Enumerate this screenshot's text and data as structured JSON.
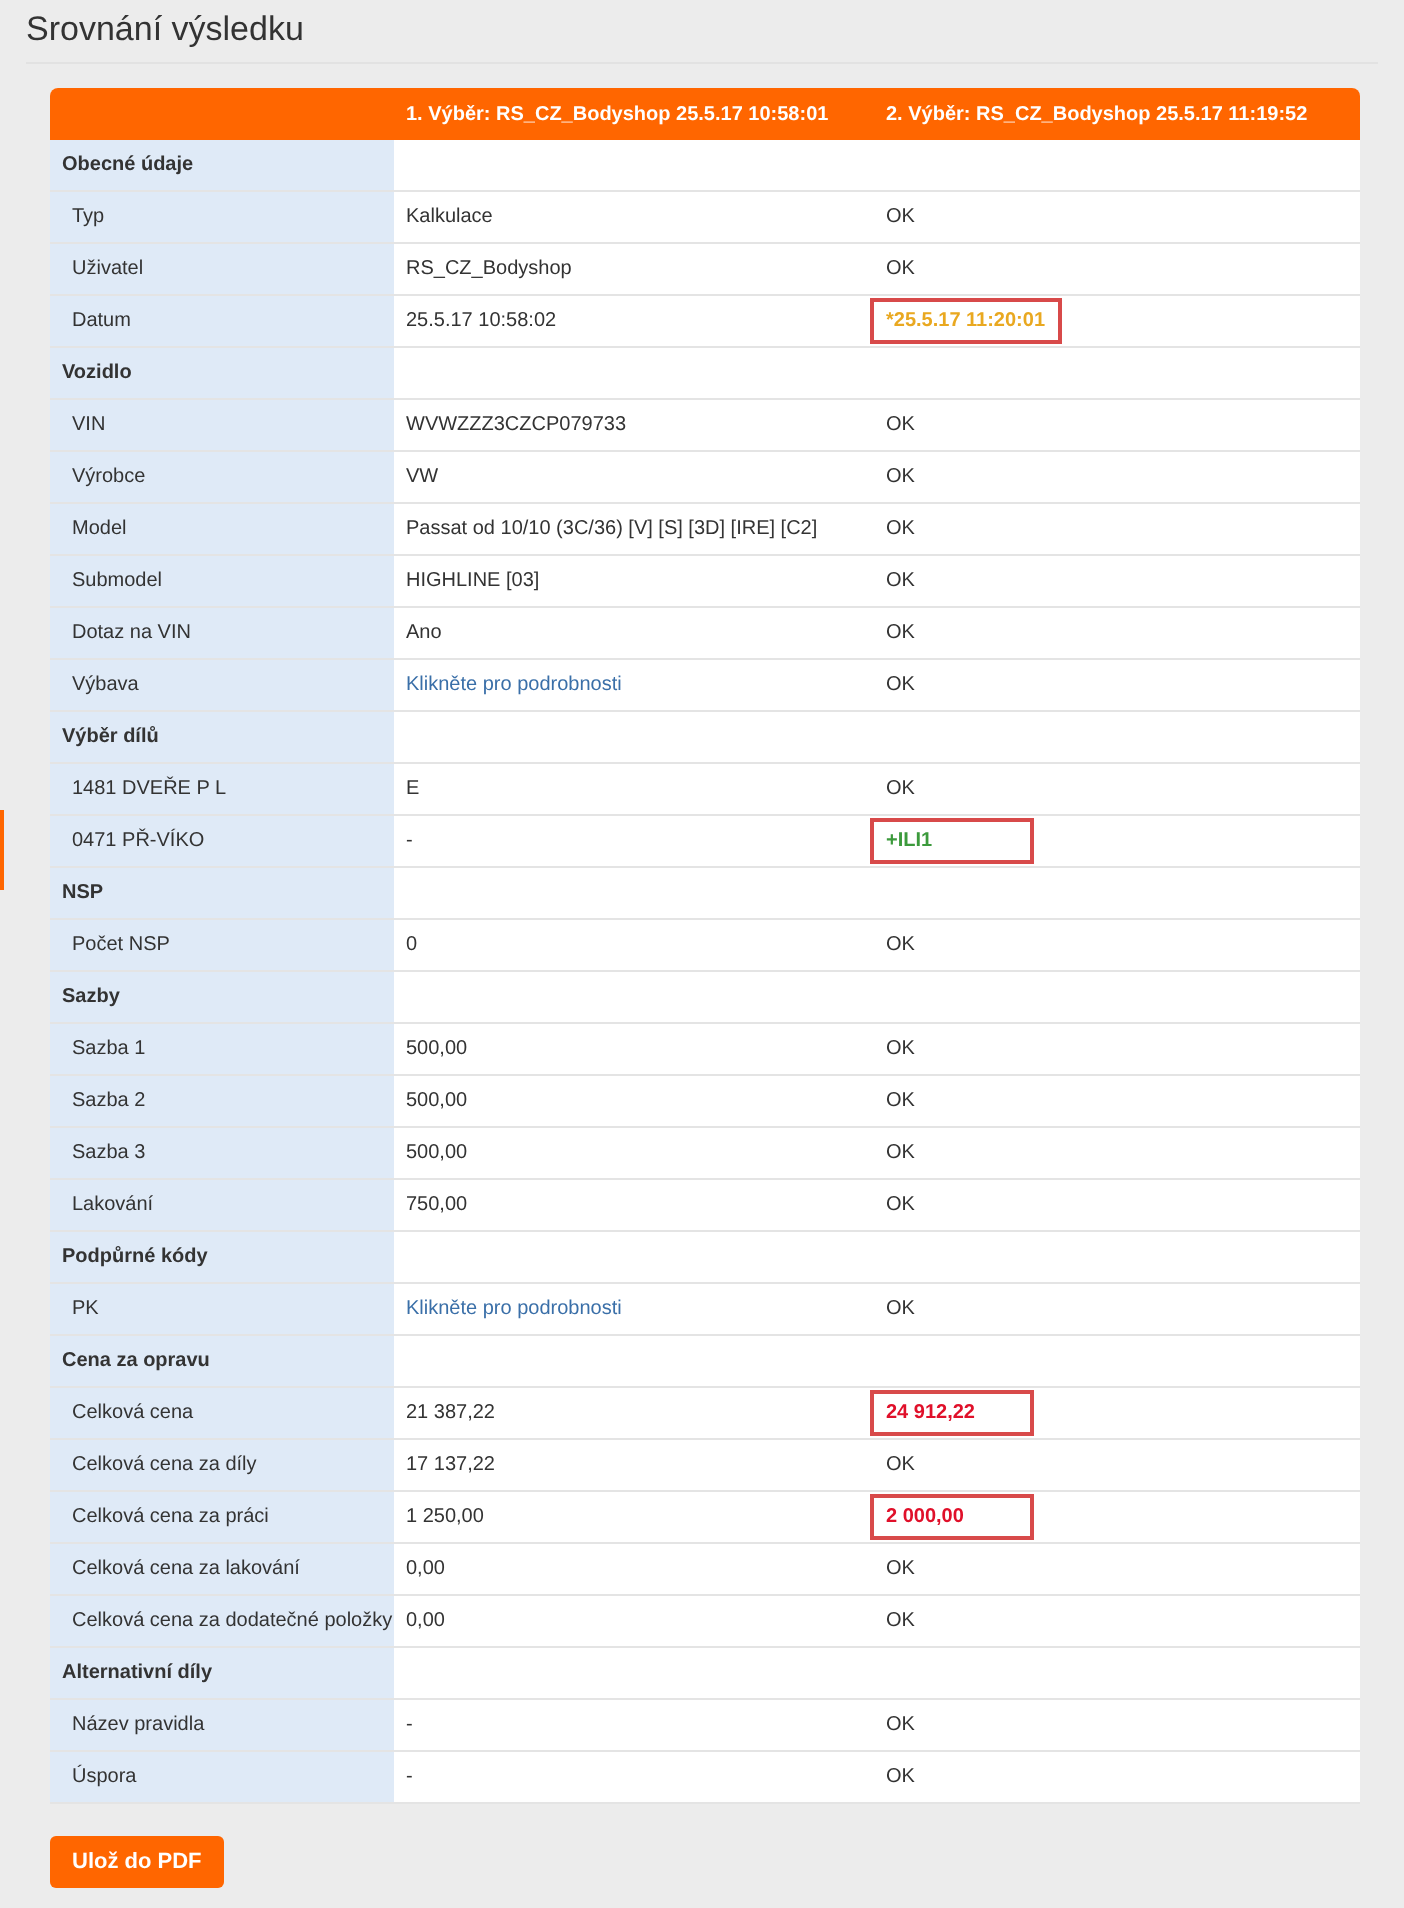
{
  "title": "Srovnání výsledku",
  "columns": [
    "",
    "1. Výběr: RS_CZ_Bodyshop 25.5.17 10:58:01",
    "2. Výběr: RS_CZ_Bodyshop 25.5.17 11:19:52"
  ],
  "sections": [
    {
      "title": "Obecné údaje",
      "rows": [
        {
          "label": "Typ",
          "value": "Kalkulace",
          "link": false,
          "result": "OK",
          "kind": "ok"
        },
        {
          "label": "Uživatel",
          "value": "RS_CZ_Bodyshop",
          "link": false,
          "result": "OK",
          "kind": "ok"
        },
        {
          "label": "Datum",
          "value": "25.5.17 10:58:02",
          "link": false,
          "result": "*25.5.17 11:20:01",
          "kind": "changed"
        }
      ]
    },
    {
      "title": "Vozidlo",
      "rows": [
        {
          "label": "VIN",
          "value": "WVWZZZ3CZCP079733",
          "link": false,
          "result": "OK",
          "kind": "ok"
        },
        {
          "label": "Výrobce",
          "value": "VW",
          "link": false,
          "result": "OK",
          "kind": "ok"
        },
        {
          "label": "Model",
          "value": "Passat od 10/10 (3C/36) [V] [S] [3D] [IRE] [C2]",
          "link": false,
          "result": "OK",
          "kind": "ok"
        },
        {
          "label": "Submodel",
          "value": "HIGHLINE [03]",
          "link": false,
          "result": "OK",
          "kind": "ok"
        },
        {
          "label": "Dotaz na VIN",
          "value": "Ano",
          "link": false,
          "result": "OK",
          "kind": "ok"
        },
        {
          "label": "Výbava",
          "value": "Klikněte pro podrobnosti",
          "link": true,
          "result": "OK",
          "kind": "ok"
        }
      ]
    },
    {
      "title": "Výběr dílů",
      "rows": [
        {
          "label": "1481 DVEŘE P L",
          "value": "E",
          "link": false,
          "result": "OK",
          "kind": "ok"
        },
        {
          "label": "0471 PŘ-VÍKO",
          "value": "-",
          "link": false,
          "result": "+ILI1",
          "kind": "added"
        }
      ]
    },
    {
      "title": "NSP",
      "rows": [
        {
          "label": "Počet NSP",
          "value": "0",
          "link": false,
          "result": "OK",
          "kind": "ok"
        }
      ]
    },
    {
      "title": "Sazby",
      "rows": [
        {
          "label": "Sazba 1",
          "value": "500,00",
          "link": false,
          "result": "OK",
          "kind": "ok"
        },
        {
          "label": "Sazba 2",
          "value": "500,00",
          "link": false,
          "result": "OK",
          "kind": "ok"
        },
        {
          "label": "Sazba 3",
          "value": "500,00",
          "link": false,
          "result": "OK",
          "kind": "ok"
        },
        {
          "label": "Lakování",
          "value": "750,00",
          "link": false,
          "result": "OK",
          "kind": "ok"
        }
      ]
    },
    {
      "title": "Podpůrné kódy",
      "rows": [
        {
          "label": "PK",
          "value": "Klikněte pro podrobnosti",
          "link": true,
          "result": "OK",
          "kind": "ok"
        }
      ]
    },
    {
      "title": "Cena za opravu",
      "rows": [
        {
          "label": "Celková cena",
          "value": "21 387,22",
          "link": false,
          "result": "24 912,22",
          "kind": "different"
        },
        {
          "label": "Celková cena za díly",
          "value": "17 137,22",
          "link": false,
          "result": "OK",
          "kind": "ok"
        },
        {
          "label": "Celková cena za práci",
          "value": "1 250,00",
          "link": false,
          "result": "2 000,00",
          "kind": "different"
        },
        {
          "label": "Celková cena za lakování",
          "value": "0,00",
          "link": false,
          "result": "OK",
          "kind": "ok"
        },
        {
          "label": "Celková cena za dodatečné položky",
          "value": "0,00",
          "link": false,
          "result": "OK",
          "kind": "ok"
        }
      ]
    },
    {
      "title": "Alternativní díly",
      "rows": [
        {
          "label": "Název pravidla",
          "value": "-",
          "link": false,
          "result": "OK",
          "kind": "ok"
        },
        {
          "label": "Úspora",
          "value": "-",
          "link": false,
          "result": "OK",
          "kind": "ok"
        }
      ]
    }
  ],
  "pdf_button": "Ulož do PDF"
}
